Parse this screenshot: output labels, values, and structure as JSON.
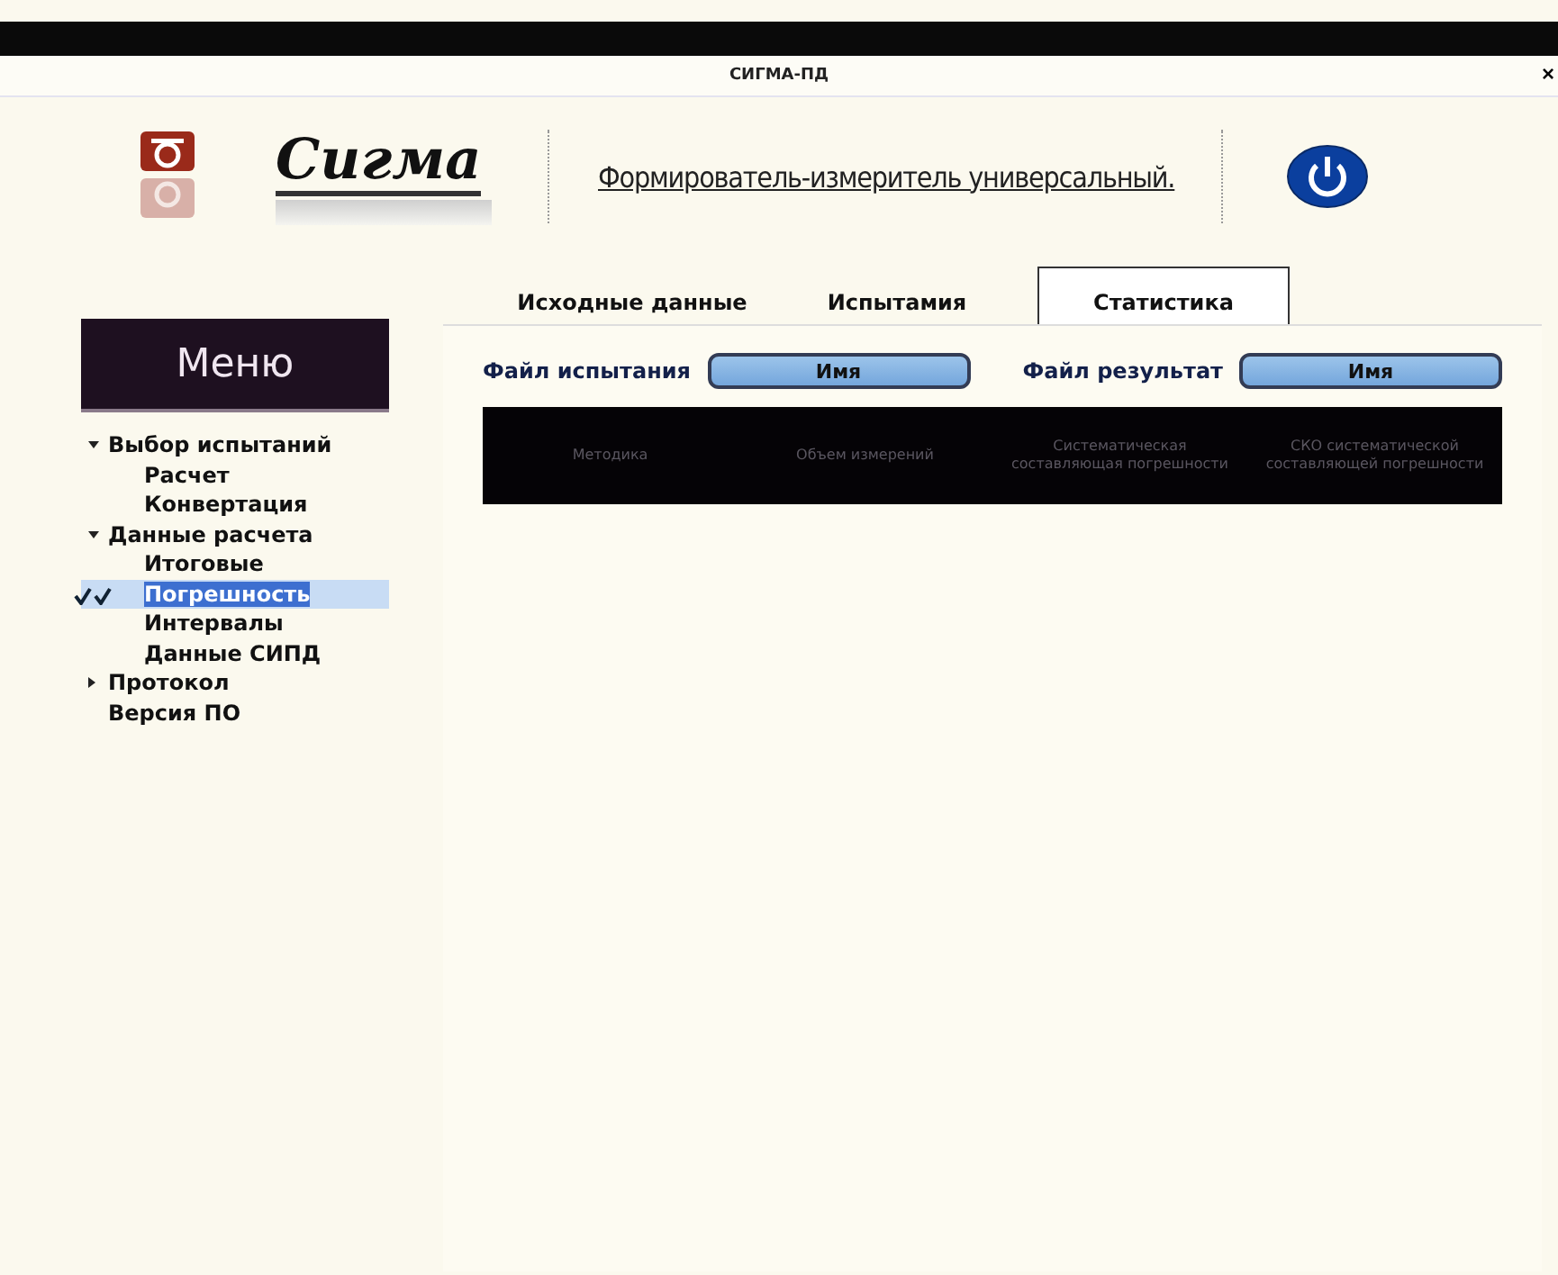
{
  "window": {
    "title": "СИГМА-ПД",
    "close": "×"
  },
  "header": {
    "logo": "Сигма",
    "subtitle": "Формирователь-измеритель универсальный."
  },
  "tabs": [
    {
      "label": "Исходные данные",
      "selected": false
    },
    {
      "label": "Испытамия",
      "selected": false
    },
    {
      "label": "Статистика",
      "selected": true
    }
  ],
  "sidebar": {
    "title": "Меню",
    "items": [
      {
        "label": "Выбор испытаний",
        "expanded": true,
        "selected": false,
        "children": [
          {
            "label": "Расчет",
            "selected": false
          },
          {
            "label": "Конвертация",
            "selected": false
          }
        ]
      },
      {
        "label": "Данные расчета",
        "expanded": true,
        "selected": false,
        "children": [
          {
            "label": "Итоговые",
            "selected": false
          },
          {
            "label": "Погрешность",
            "selected": true
          },
          {
            "label": "Интервалы",
            "selected": false
          },
          {
            "label": "Данные СИПД",
            "selected": false
          }
        ]
      },
      {
        "label": "Протокол",
        "expanded": false,
        "selected": false
      },
      {
        "label": "Версия ПО",
        "selected": false
      }
    ]
  },
  "files": [
    {
      "label": "Файл испытания",
      "button": "Имя"
    },
    {
      "label": "Файл результат",
      "button": "Имя"
    }
  ],
  "table": {
    "columns": [
      "Методика",
      "Объем измерений",
      "Систематическая составляющая погрешности",
      "СКО систематической составляющей погрешности"
    ]
  }
}
